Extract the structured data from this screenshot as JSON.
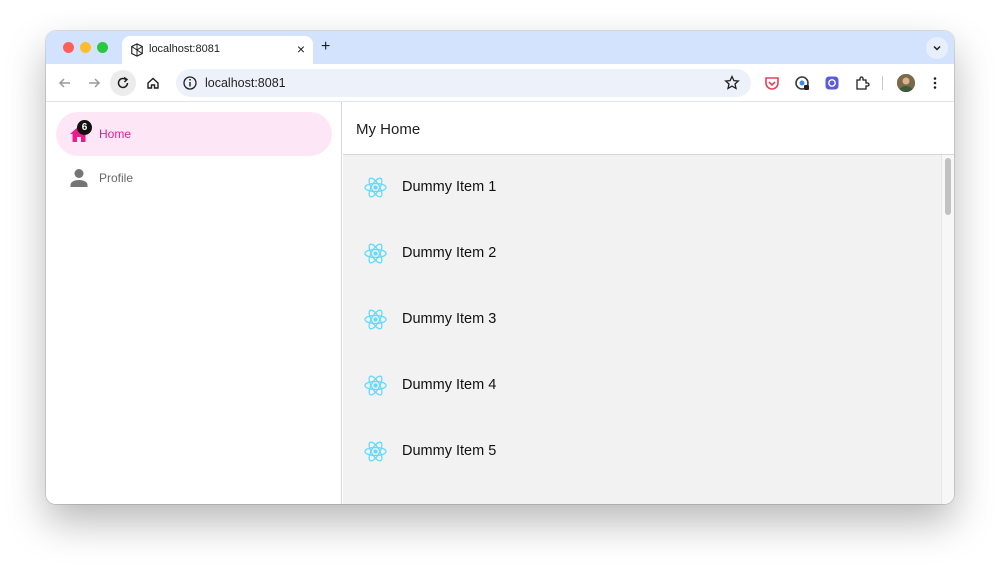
{
  "browser": {
    "tab_title": "localhost:8081",
    "tab_close": "×",
    "new_tab": "+",
    "url": "localhost:8081",
    "tab_search": "chevron-down-icon"
  },
  "sidebar": {
    "items": [
      {
        "label": "Home",
        "icon": "home-icon",
        "badge": "6",
        "active": true
      },
      {
        "label": "Profile",
        "icon": "person-icon",
        "active": false
      }
    ]
  },
  "main": {
    "title": "My Home",
    "items": [
      {
        "label": "Dummy Item 1",
        "icon": "react-atom-icon"
      },
      {
        "label": "Dummy Item 2",
        "icon": "react-atom-icon"
      },
      {
        "label": "Dummy Item 3",
        "icon": "react-atom-icon"
      },
      {
        "label": "Dummy Item 4",
        "icon": "react-atom-icon"
      },
      {
        "label": "Dummy Item 5",
        "icon": "react-atom-icon"
      }
    ]
  },
  "colors": {
    "accent": "#e91e8c",
    "active_bg": "#fde7f7",
    "tabstrip": "#d3e3fd",
    "react_icon": "#61dafb",
    "list_bg": "#f2f2f2"
  }
}
